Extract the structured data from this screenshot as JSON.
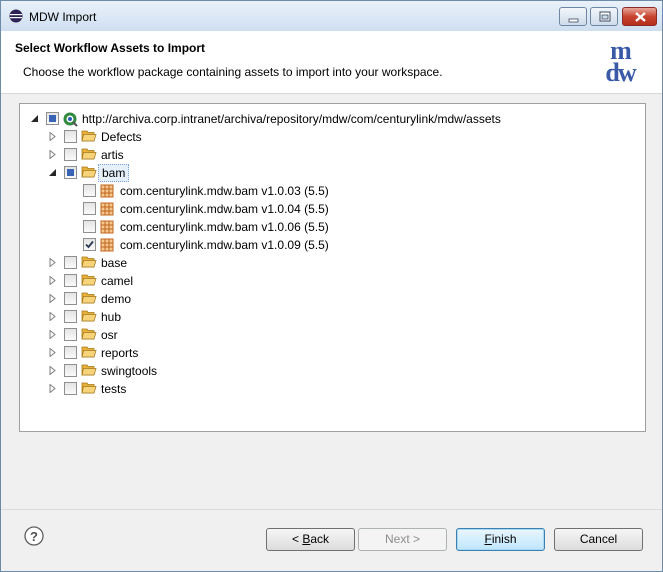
{
  "window": {
    "title": "MDW Import"
  },
  "header": {
    "title": "Select Workflow Assets to Import",
    "description": "Choose the workflow package containing assets to import into your workspace.",
    "logo_text": "mdw"
  },
  "tree": {
    "root": {
      "label": "http://archiva.corp.intranet/archiva/repository/mdw/com/centurylink/mdw/assets",
      "expanded": true,
      "check_state": "partial"
    },
    "items": [
      {
        "label": "Defects",
        "expanded": false,
        "checked": false
      },
      {
        "label": "artis",
        "expanded": false,
        "checked": false
      },
      {
        "label": "bam",
        "expanded": true,
        "checked": "partial",
        "selected": true,
        "children": [
          {
            "label": "com.centurylink.mdw.bam v1.0.03 (5.5)",
            "checked": false
          },
          {
            "label": "com.centurylink.mdw.bam v1.0.04 (5.5)",
            "checked": false
          },
          {
            "label": "com.centurylink.mdw.bam v1.0.06 (5.5)",
            "checked": false
          },
          {
            "label": "com.centurylink.mdw.bam v1.0.09 (5.5)",
            "checked": true
          }
        ]
      },
      {
        "label": "base",
        "expanded": false,
        "checked": false
      },
      {
        "label": "camel",
        "expanded": false,
        "checked": false
      },
      {
        "label": "demo",
        "expanded": false,
        "checked": false
      },
      {
        "label": "hub",
        "expanded": false,
        "checked": false
      },
      {
        "label": "osr",
        "expanded": false,
        "checked": false
      },
      {
        "label": "reports",
        "expanded": false,
        "checked": false
      },
      {
        "label": "swingtools",
        "expanded": false,
        "checked": false
      },
      {
        "label": "tests",
        "expanded": false,
        "checked": false
      }
    ]
  },
  "footer": {
    "help_icon": "help-icon",
    "back": {
      "prefix": "< ",
      "mnemonic": "B",
      "rest": "ack"
    },
    "next": "Next >",
    "finish": {
      "mnemonic": "F",
      "rest": "inish"
    },
    "cancel": "Cancel"
  },
  "colors": {
    "accent": "#3a63b5",
    "folder": "#f0c04a",
    "package": "#d2691e",
    "logo": "#3a5aa8"
  }
}
